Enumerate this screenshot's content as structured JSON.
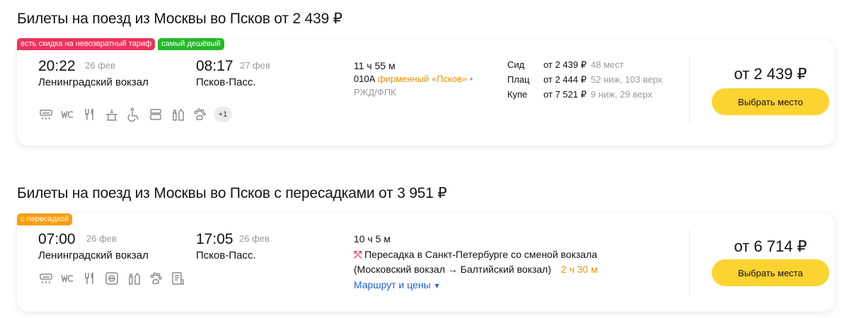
{
  "section1": {
    "title": "Билеты на поезд из Москвы во Псков от 2 439 ₽"
  },
  "card1": {
    "badges": [
      {
        "label": "есть скидка на невозвратный тариф",
        "color": "#f0325b"
      },
      {
        "label": "самый дешёвый",
        "color": "#22b928"
      }
    ],
    "departure": {
      "time": "20:22",
      "date": "26 фев",
      "station": "Ленинградский вокзал"
    },
    "arrival": {
      "time": "08:17",
      "date": "27 фев",
      "station": "Псков-Пасс."
    },
    "duration": "11 ч 55 м",
    "train_number": "010А",
    "train_name": "фирменный «Псков»",
    "dot": "•",
    "carrier": "РЖД/ФПК",
    "classes": [
      {
        "name": "Сид",
        "price": "от 2 439 ₽",
        "seats": "48 мест"
      },
      {
        "name": "Плац",
        "price": "от 2 444 ₽",
        "seats": "52 ниж, 103 верх"
      },
      {
        "name": "Купе",
        "price": "от 7 521 ₽",
        "seats": "9 ниж, 29 верх"
      }
    ],
    "amenities": [
      "air-conditioner-icon",
      "wc-icon",
      "meals-icon",
      "restaurant-car-icon",
      "accessible-icon",
      "linen-icon",
      "hygiene-kit-icon",
      "pets-icon"
    ],
    "amenities_more": "+1",
    "price": "от 2 439 ₽",
    "button_label": "Выбрать место"
  },
  "section2": {
    "title": "Билеты на поезд из Москвы во Псков с пересадками от 3 951 ₽"
  },
  "card2": {
    "badges": [
      {
        "label": "с пересадкой",
        "color": "#ff9d0a"
      }
    ],
    "departure": {
      "time": "07:00",
      "date": "26 фев",
      "station": "Ленинградский вокзал"
    },
    "arrival": {
      "time": "17:05",
      "date": "26 фев",
      "station": "Псков-Пасс."
    },
    "duration": "10 ч 5 м",
    "transfer_line1": "Пересадка в Санкт-Петербурге со сменой вокзала",
    "transfer_line2": "(Московский вокзал → Балтийский вокзал)",
    "transfer_time": "2 ч 30 м",
    "route_link": "Маршрут и цены",
    "route_caret": "▾",
    "amenities": [
      "air-conditioner-icon",
      "wc-icon",
      "meals-icon",
      "socket-icon",
      "hygiene-kit-icon",
      "pets-icon",
      "menu-icon"
    ],
    "price": "от 6 714 ₽",
    "button_label": "Выбрать места"
  },
  "colors": {
    "accent_button": "#fcd330",
    "link": "#1d5fd6",
    "orange": "#f39200",
    "icon": "#8c8c8c"
  }
}
